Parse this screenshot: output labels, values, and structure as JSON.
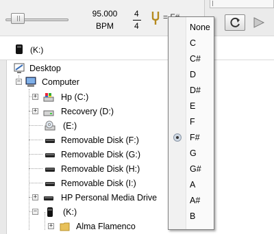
{
  "toolbar": {
    "tempo_value": "95.000",
    "tempo_unit": "BPM",
    "time_signature_numerator": "4",
    "time_signature_denominator": "4",
    "key_display": "= F#"
  },
  "drive_bar": {
    "label": "(K:)"
  },
  "tree": {
    "items": [
      {
        "label": "Desktop",
        "icon": "desktop-icon"
      },
      {
        "label": "Computer",
        "icon": "computer-icon"
      },
      {
        "label": "Hp (C:)",
        "icon": "hard-drive-icon"
      },
      {
        "label": "Recovery (D:)",
        "icon": "hard-drive-icon"
      },
      {
        "label": "(E:)",
        "icon": "dvd-drive-icon"
      },
      {
        "label": "Removable Disk (F:)",
        "icon": "removable-disk-icon"
      },
      {
        "label": "Removable Disk (G:)",
        "icon": "removable-disk-icon"
      },
      {
        "label": "Removable Disk (H:)",
        "icon": "removable-disk-icon"
      },
      {
        "label": "Removable Disk (I:)",
        "icon": "removable-disk-icon"
      },
      {
        "label": "HP Personal Media Drive",
        "icon": "removable-disk-icon"
      },
      {
        "label": "(K:)",
        "icon": "usb-drive-icon"
      },
      {
        "label": "Alma Flamenco",
        "icon": "folder-icon"
      }
    ]
  },
  "key_menu": {
    "items": [
      "None",
      "C",
      "C#",
      "D",
      "D#",
      "E",
      "F",
      "F#",
      "G",
      "G#",
      "A",
      "A#",
      "B"
    ],
    "selected": "F#"
  },
  "colors": {
    "toolbar_bg": "#f0f0f0",
    "menu_bg": "#fafafa",
    "folder": "#e8c15a",
    "monitor": "#3a6fb8"
  }
}
